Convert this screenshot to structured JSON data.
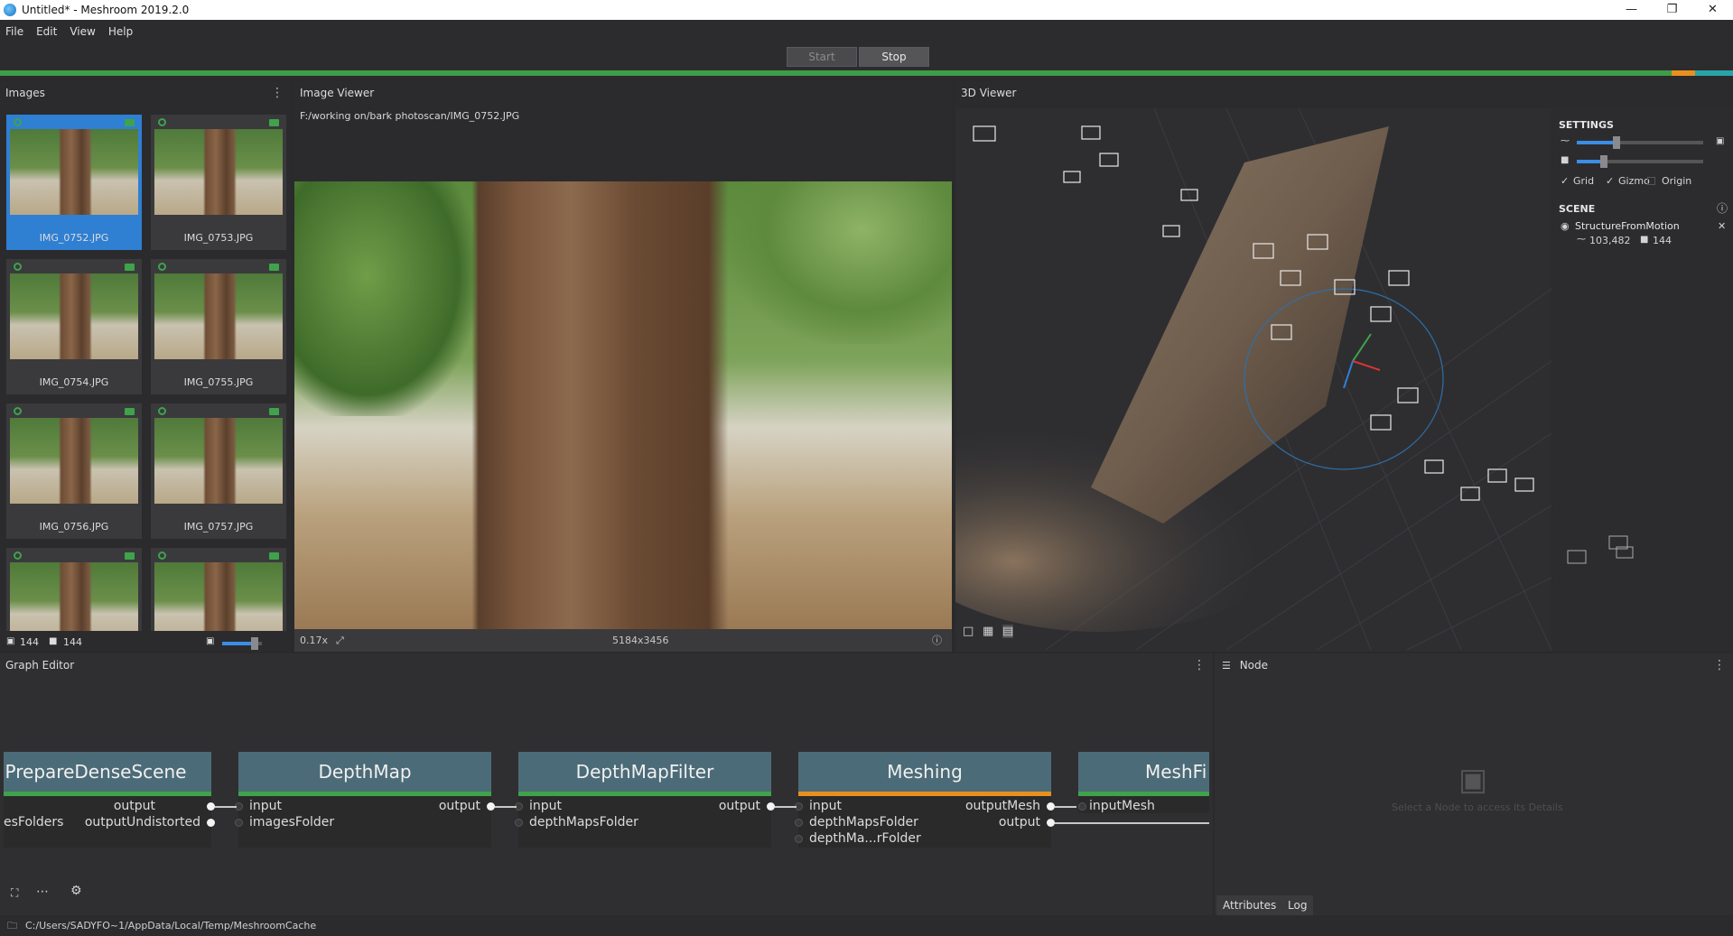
{
  "window": {
    "title": "Untitled* - Meshroom 2019.2.0"
  },
  "menu": [
    "File",
    "Edit",
    "View",
    "Help"
  ],
  "toolbar": {
    "start_label": "Start",
    "stop_label": "Stop"
  },
  "images_panel": {
    "title": "Images",
    "thumbnails": [
      "IMG_0752.JPG",
      "IMG_0753.JPG",
      "IMG_0754.JPG",
      "IMG_0755.JPG",
      "IMG_0756.JPG",
      "IMG_0757.JPG",
      "",
      ""
    ],
    "selected_index": 0,
    "image_count": "144",
    "camera_count": "144"
  },
  "image_viewer": {
    "title": "Image Viewer",
    "path": "F:/working on/bark photoscan/IMG_0752.JPG",
    "zoom": "0.17x",
    "resolution": "5184x3456"
  },
  "viewer3d": {
    "title": "3D Viewer",
    "settings_title": "SETTINGS",
    "grid_label": "Grid",
    "gizmo_label": "Gizmo",
    "origin_label": "Origin",
    "grid_checked": true,
    "gizmo_checked": true,
    "origin_checked": false,
    "point_size_level": 0.3,
    "camera_scale_level": 0.2,
    "scene_title": "SCENE",
    "scene_item": "StructureFromMotion",
    "points": "103,482",
    "cameras": "144"
  },
  "graph_editor": {
    "title": "Graph Editor",
    "nodes": [
      {
        "name": "PrepareDenseScene",
        "inputs": [
          "esFolders"
        ],
        "outputs": [
          "output",
          "outputUndistorted"
        ]
      },
      {
        "name": "DepthMap",
        "inputs": [
          "input",
          "imagesFolder"
        ],
        "outputs": [
          "output"
        ]
      },
      {
        "name": "DepthMapFilter",
        "inputs": [
          "input",
          "depthMapsFolder"
        ],
        "outputs": [
          "output"
        ]
      },
      {
        "name": "Meshing",
        "inputs": [
          "input",
          "depthMapsFolder",
          "depthMa...rFolder"
        ],
        "outputs": [
          "outputMesh",
          "output"
        ]
      },
      {
        "name": "MeshFi",
        "inputs": [
          "inputMesh"
        ],
        "outputs": []
      }
    ]
  },
  "node_panel": {
    "title": "Node",
    "placeholder": "Select a Node to access its Details",
    "tabs": [
      "Attributes",
      "Log"
    ]
  },
  "status": {
    "cache_path": "C:/Users/SADYFO~1/AppData/Local/Temp/MeshroomCache"
  },
  "colors": {
    "accent": "#3a8ee6",
    "success": "#3ea34a",
    "running": "#e8901e",
    "node_header": "#4c6b78"
  }
}
